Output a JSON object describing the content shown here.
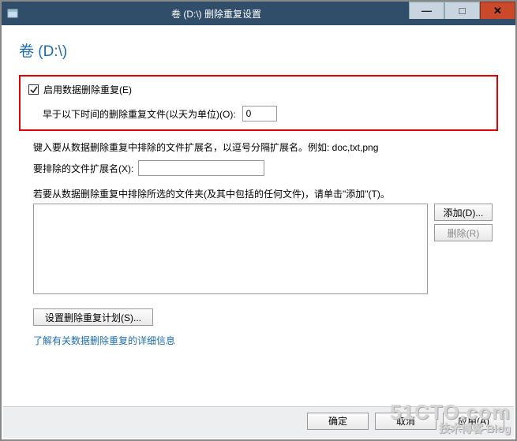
{
  "window": {
    "title": "卷 (D:\\) 删除重复设置"
  },
  "heading": "卷 (D:\\)",
  "enable": {
    "label": "启用数据删除重复(E)",
    "checked": true
  },
  "days": {
    "label": "早于以下时间的删除重复文件(以天为单位)(O):",
    "value": "0"
  },
  "extensions": {
    "hint": "键入要从数据删除重复中排除的文件扩展名，以逗号分隔扩展名。例如: doc,txt,png",
    "label": "要排除的文件扩展名(X):",
    "value": ""
  },
  "folders": {
    "hint": "若要从数据删除重复中排除所选的文件夹(及其中包括的任何文件)，请单击\"添加\"(T)。",
    "add_label": "添加(D)...",
    "remove_label": "删除(R)"
  },
  "schedule_button": "设置删除重复计划(S)...",
  "learn_more_link": "了解有关数据删除重复的详细信息",
  "footer": {
    "ok": "确定",
    "cancel": "取消",
    "apply": "应用(A)"
  },
  "watermark": {
    "line1": "51CTO.com",
    "line2": "技术博客 Blog"
  }
}
